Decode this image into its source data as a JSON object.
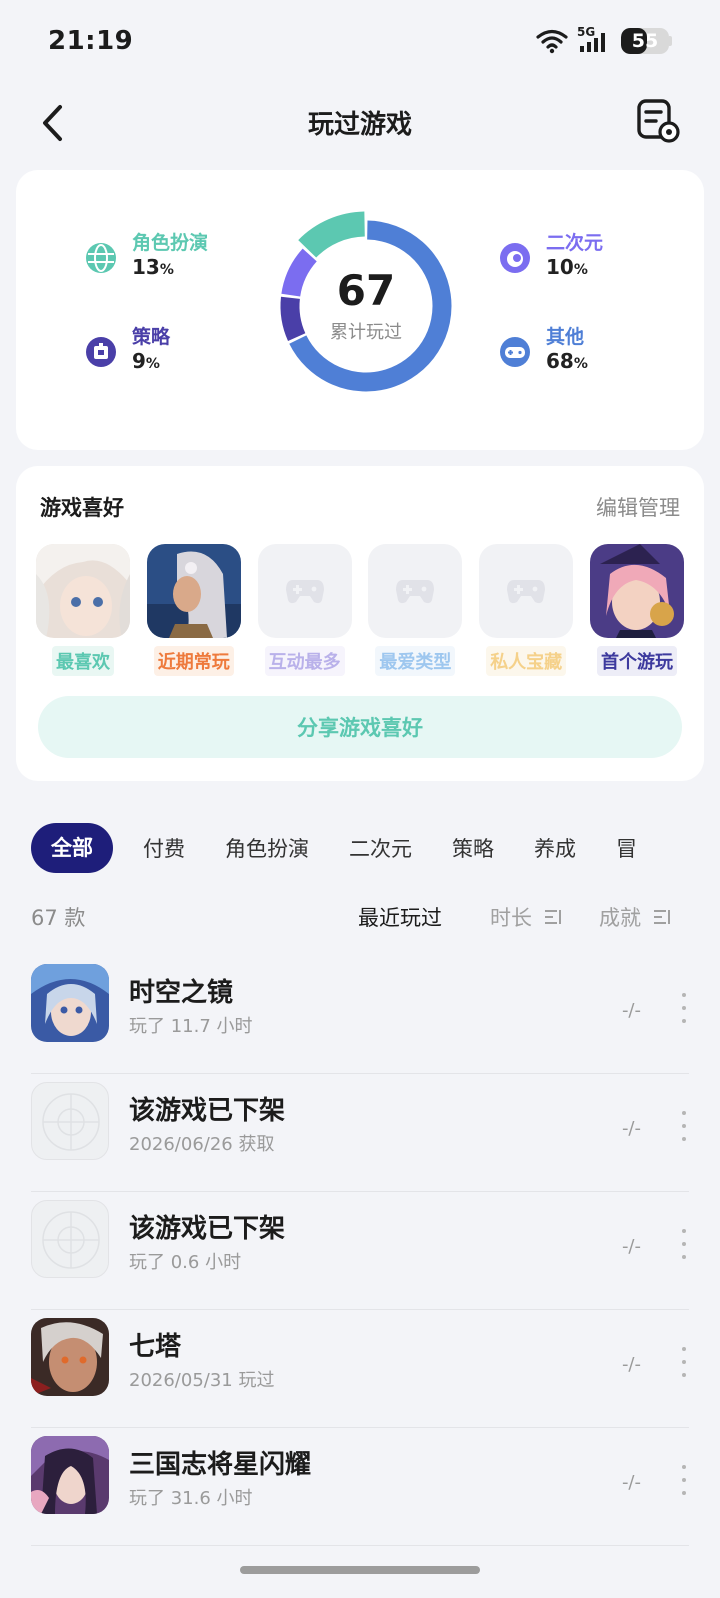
{
  "status_bar": {
    "time": "21:19",
    "network": "5G",
    "battery": "55"
  },
  "header": {
    "title": "玩过游戏"
  },
  "stats": {
    "total": "67",
    "total_label": "累计玩过",
    "categories": [
      {
        "name": "角色扮演",
        "pct": "13",
        "icon": "globe-icon",
        "color": "#5cc8b1"
      },
      {
        "name": "策略",
        "pct": "9",
        "icon": "strategy-icon",
        "color": "#4a3fa8"
      },
      {
        "name": "二次元",
        "pct": "10",
        "icon": "anime-icon",
        "color": "#7b6df0"
      },
      {
        "name": "其他",
        "pct": "68",
        "icon": "gamepad-icon",
        "color": "#4f7fd6"
      }
    ],
    "pct_unit": "%"
  },
  "preferences": {
    "title": "游戏喜好",
    "edit_label": "编辑管理",
    "items": [
      {
        "label": "最喜欢",
        "color": "#5cc8b1",
        "bg": "#e9f7f3",
        "filled": true
      },
      {
        "label": "近期常玩",
        "color": "#ee7a3c",
        "bg": "#fdf0e6",
        "filled": true
      },
      {
        "label": "互动最多",
        "color": "#b9b1ea",
        "bg": "#f6f4fc",
        "filled": false
      },
      {
        "label": "最爱类型",
        "color": "#9ec7ef",
        "bg": "#f2f7fc",
        "filled": false
      },
      {
        "label": "私人宝藏",
        "color": "#f5d18a",
        "bg": "#fcf7ec",
        "filled": false
      },
      {
        "label": "首个游玩",
        "color": "#3d3a9e",
        "bg": "#ededf7",
        "filled": true
      }
    ],
    "share_label": "分享游戏喜好"
  },
  "tabs": [
    "全部",
    "付费",
    "角色扮演",
    "二次元",
    "策略",
    "养成",
    "冒"
  ],
  "list_meta": {
    "count": "67 款",
    "sort_recent": "最近玩过",
    "sort_duration": "时长",
    "sort_achievement": "成就"
  },
  "games": [
    {
      "name": "时空之镜",
      "sub": "玩了 11.7 小时",
      "achievement": "-/-",
      "icon": "art"
    },
    {
      "name": "该游戏已下架",
      "sub": "2026/06/26 获取",
      "achievement": "-/-",
      "icon": "empty"
    },
    {
      "name": "该游戏已下架",
      "sub": "玩了 0.6 小时",
      "achievement": "-/-",
      "icon": "empty"
    },
    {
      "name": "七塔",
      "sub": "2026/05/31 玩过",
      "achievement": "-/-",
      "icon": "art"
    },
    {
      "name": "三国志将星闪耀",
      "sub": "玩了 31.6 小时",
      "achievement": "-/-",
      "icon": "art"
    }
  ]
}
